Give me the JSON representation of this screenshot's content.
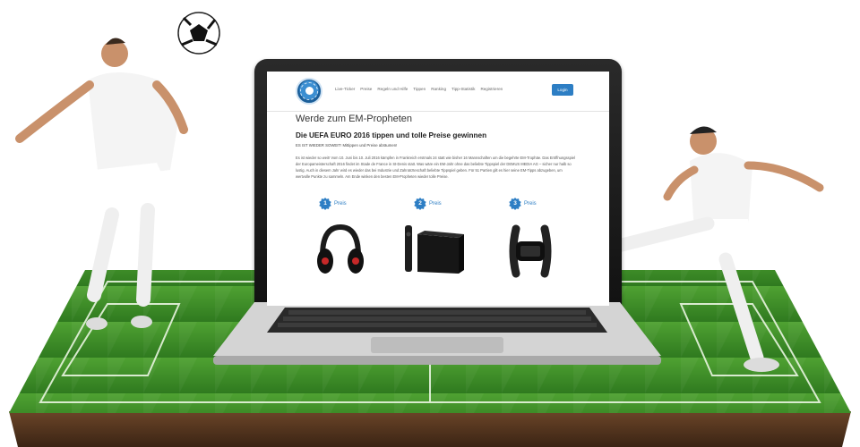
{
  "site": {
    "nav": [
      "Live-Ticker",
      "Preise",
      "Regeln und Hilfe",
      "Tippen",
      "Ranking",
      "Tipp-Statistik",
      "Registrieren"
    ],
    "login_label": "Login",
    "page_title": "Werde zum EM-Propheten",
    "headline": "Die UEFA EURO 2016 tippen und tolle Preise gewinnen",
    "tagline": "ES IST WIEDER SOWEIT! Mitt­ippen und Preise abräumen!",
    "paragraph": "Es ist wieder so weit! Vom 10. Juni bis 10. Juli 2016 kämpfen in Frankreich erstmals 24 statt wie bisher 16 Mannschaften um die begehrte EM-Trophäe. Das Eröffnungsspiel der Europameisterschaft 2016 findet im Stade de France in St-Denis statt. Was wäre ein EM-Jahr ohne das beliebte Tippspiel der DEMUS MEDIA AG – sicher nur halb so lustig. Auch in diesem Jahr wird es wieder das bei Industrie und Zahnärzteschaft beliebte Tippspiel geben. Für 51 Partien gilt es hier seine EM-Tipps abzugeben, um wertvolle Punkte zu sammeln. Am Ende winken den besten EM-Propheten wieder tolle Preise.",
    "prizes": [
      {
        "number": "1",
        "label": "Preis",
        "product": "headphones-image"
      },
      {
        "number": "2",
        "label": "Preis",
        "product": "tv-box-image"
      },
      {
        "number": "3",
        "label": "Preis",
        "product": "fitness-tracker-image"
      }
    ]
  },
  "colors": {
    "accent": "#2d7ec4",
    "grass": "#3f8f2a",
    "soil": "#5a3a22",
    "laptop_frame": "#1a1a1a",
    "laptop_base": "#c9c9c9"
  },
  "icons": [
    "soccer-ball-icon",
    "site-logo-icon",
    "prize-badge-icon"
  ]
}
